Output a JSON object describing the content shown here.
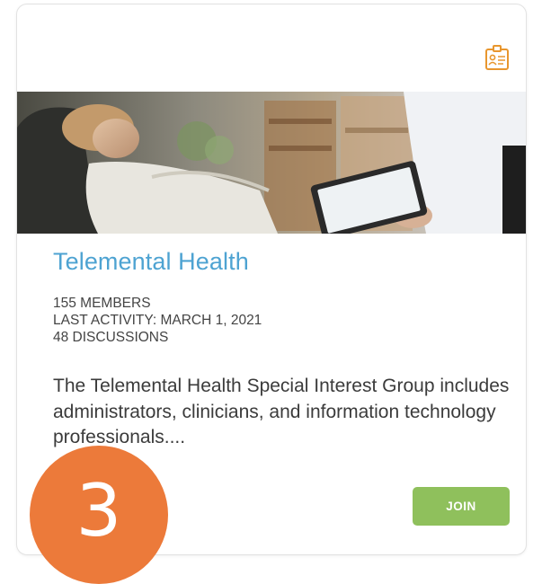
{
  "card": {
    "title": "Telemental Health",
    "meta": [
      "155 MEMBERS",
      "LAST ACTIVITY: MARCH 1, 2021",
      "48 DISCUSSIONS"
    ],
    "description": "The Telemental Health Special Interest Group includes administrators, clinicians, and information technology professionals....",
    "join_label": "JOIN",
    "badge_icon": "id-badge-icon"
  },
  "step_marker": "3",
  "colors": {
    "title": "#4ea3d2",
    "join_button": "#8fc05c",
    "icon": "#e8962e",
    "step_marker": "#ec7a3a"
  }
}
